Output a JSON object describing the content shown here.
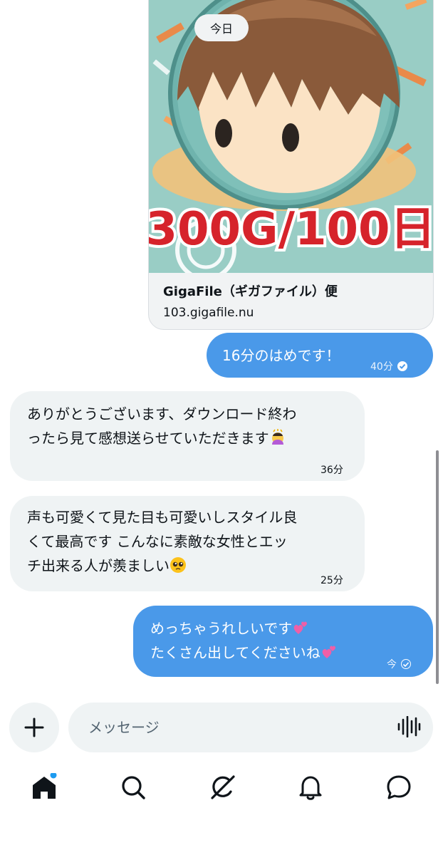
{
  "link_card": {
    "image_caption": "300G/100日",
    "title": "GigaFile（ギガファイル）便",
    "domain": "103.gigafile.nu"
  },
  "date_separator": "今日",
  "messages": [
    {
      "direction": "sent",
      "lines": [
        "16分のはめです！"
      ],
      "time": "40分",
      "status": "read"
    },
    {
      "direction": "received",
      "lines": [
        "ありがとうございます、ダウンロード終わ",
        "ったら見て感想送らせていただきます"
      ],
      "emoji": "person-bowing",
      "time": "36分"
    },
    {
      "direction": "received",
      "lines": [
        "声も可愛くて見た目も可愛いしスタイル良",
        "くて最高です  こんなに素敵な女性とエッ",
        "チ出来る人が羨ましい"
      ],
      "emoji": "pleading-face",
      "time": "25分"
    },
    {
      "direction": "sent",
      "lines": [
        "めっちゃうれしいです",
        "たくさん出してくださいね"
      ],
      "emoji": "two-hearts",
      "time": "今",
      "status": "sent"
    }
  ],
  "composer": {
    "placeholder": "メッセージ",
    "add_icon": "plus-icon",
    "voice_icon": "voice-wave-icon"
  },
  "nav": {
    "items": [
      "home-icon",
      "search-icon",
      "grok-icon",
      "notifications-icon",
      "messages-icon"
    ],
    "active": "home-icon",
    "notification_dot_color": "#1d9bf0"
  },
  "colors": {
    "sent_bubble": "#4a99e9",
    "received_bubble": "#eff3f4",
    "caption_red": "#d6232b"
  }
}
